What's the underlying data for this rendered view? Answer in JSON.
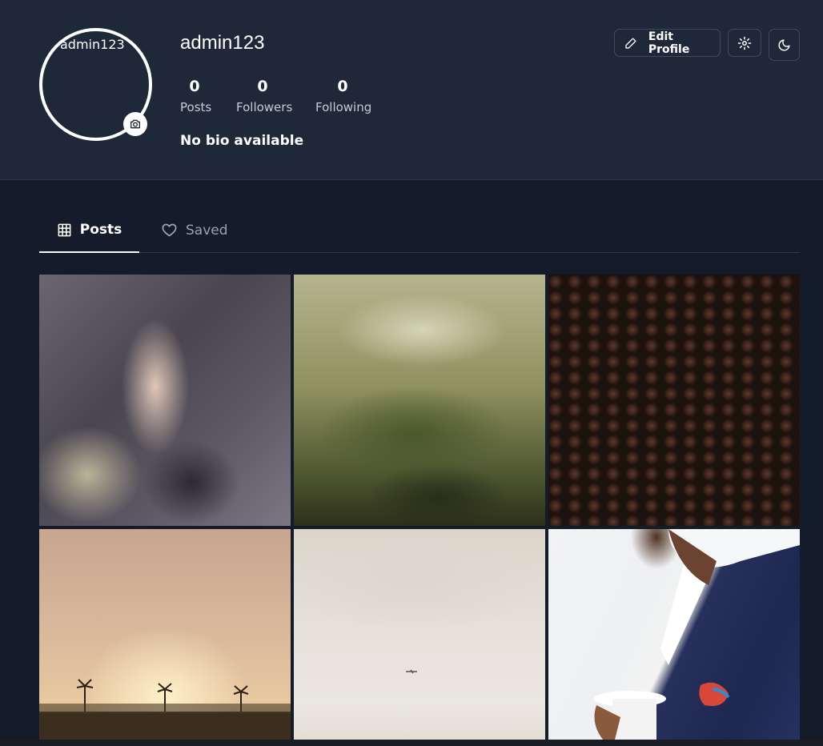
{
  "profile": {
    "username": "admin123",
    "avatar_alt": "admin123",
    "bio": "No bio available",
    "stats": [
      {
        "value": "0",
        "label": "Posts"
      },
      {
        "value": "0",
        "label": "Followers"
      },
      {
        "value": "0",
        "label": "Following"
      }
    ]
  },
  "actions": {
    "edit_label": "Edit Profile",
    "settings_icon": "gear-icon",
    "theme_icon": "moon-icon"
  },
  "tabs": [
    {
      "label": "Posts",
      "icon": "grid-icon",
      "active": true
    },
    {
      "label": "Saved",
      "icon": "heart-icon",
      "active": false
    }
  ],
  "posts": [
    {
      "description": "Person behind rainy window"
    },
    {
      "description": "Misty green landscape"
    },
    {
      "description": "Coffee beans"
    },
    {
      "description": "Palm trees at sunset"
    },
    {
      "description": "Airplane in cloudy sky"
    },
    {
      "description": "Man in suit holding coffee"
    }
  ],
  "colors": {
    "header_bg": "#1f2839",
    "page_bg": "#141b2b",
    "text_primary": "#ffffff",
    "text_muted": "#9aa2b1"
  }
}
